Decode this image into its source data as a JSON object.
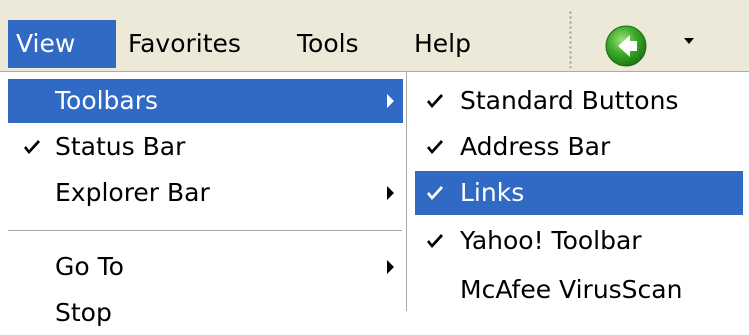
{
  "menubar": {
    "items": [
      {
        "label": "View",
        "active": true
      },
      {
        "label": "Favorites",
        "active": false
      },
      {
        "label": "Tools",
        "active": false
      },
      {
        "label": "Help",
        "active": false
      }
    ],
    "back_button": {
      "icon": "back-arrow-icon",
      "color": "#3aa928"
    }
  },
  "view_menu": {
    "items": [
      {
        "label": "Toolbars",
        "checked": false,
        "submenu": true,
        "highlighted": true
      },
      {
        "label": "Status Bar",
        "checked": true,
        "submenu": false,
        "highlighted": false
      },
      {
        "label": "Explorer Bar",
        "checked": false,
        "submenu": true,
        "highlighted": false
      },
      {
        "label": "Go To",
        "checked": false,
        "submenu": true,
        "highlighted": false
      },
      {
        "label": "Stop",
        "checked": false,
        "submenu": false,
        "highlighted": false
      }
    ]
  },
  "toolbars_submenu": {
    "items": [
      {
        "label": "Standard Buttons",
        "checked": true,
        "highlighted": false
      },
      {
        "label": "Address Bar",
        "checked": true,
        "highlighted": false
      },
      {
        "label": "Links",
        "checked": true,
        "highlighted": true
      },
      {
        "label": "Yahoo! Toolbar",
        "checked": true,
        "highlighted": false
      },
      {
        "label": "McAfee VirusScan",
        "checked": false,
        "highlighted": false
      }
    ]
  },
  "colors": {
    "highlight": "#316ac5",
    "menubar_bg": "#ece9d8",
    "separator": "#aca899"
  }
}
